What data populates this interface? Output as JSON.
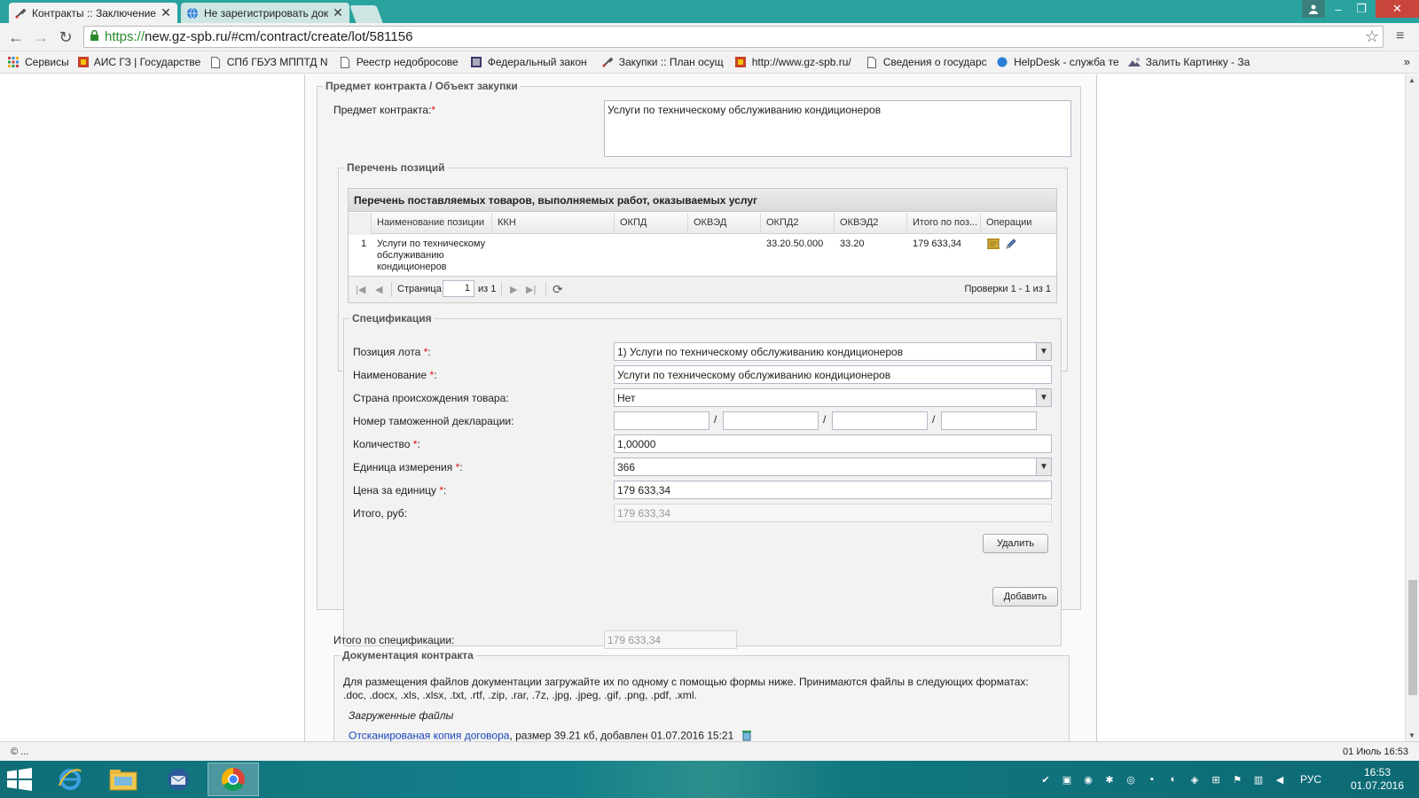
{
  "browser": {
    "tabs": [
      {
        "label": "Контракты :: Заключение",
        "icon": "tools-icon",
        "active": true
      },
      {
        "label": "Не зарегистрировать док",
        "icon": "globe-icon",
        "active": false
      }
    ],
    "url_scheme": "https://",
    "url_rest": "new.gz-spb.ru/#cm/contract/create/lot/581156",
    "bookmarks": [
      {
        "label": "Сервисы",
        "icon": "apps-icon"
      },
      {
        "label": "АИС ГЗ | Государстве",
        "icon": "gz-icon"
      },
      {
        "label": "СПб ГБУЗ МППТД N",
        "icon": "page-icon"
      },
      {
        "label": "Реестр недобросове",
        "icon": "page-icon"
      },
      {
        "label": "Федеральный закон",
        "icon": "doc-icon"
      },
      {
        "label": "Закупки :: План осущ",
        "icon": "tools-icon"
      },
      {
        "label": "http://www.gz-spb.ru/",
        "icon": "gz-icon"
      },
      {
        "label": "Сведения о государс",
        "icon": "page-icon"
      },
      {
        "label": "HelpDesk - служба те",
        "icon": "globe-icon"
      },
      {
        "label": "Залить Картинку - За",
        "icon": "image-icon"
      }
    ]
  },
  "form": {
    "section_subject_legend": "Предмет контракта / Объект закупки",
    "subject_label": "Предмет контракта:",
    "required_mark": "*",
    "subject_value": "Услуги по техническому обслуживанию кондиционеров",
    "positions_legend": "Перечень позиций",
    "grid": {
      "title": "Перечень поставляемых товаров, выполняемых работ, оказываемых услуг",
      "columns": [
        "Наименование позиции",
        "ККН",
        "ОКПД",
        "ОКВЭД",
        "ОКПД2",
        "ОКВЭД2",
        "Итого по поз...",
        "Операции"
      ],
      "row": {
        "num": "1",
        "name_line1": "Услуги по техническому",
        "name_line2": "обслуживанию",
        "name_line3": "кондиционеров",
        "kkn": "",
        "okpd": "",
        "okved": "",
        "okpd2": "33.20.50.000",
        "okved2": "33.20",
        "total": "179 633,34"
      },
      "pager": {
        "page_label": "Страница",
        "page_value": "1",
        "of_label": "из 1",
        "summary": "Проверки 1 - 1 из 1"
      }
    },
    "spec": {
      "legend": "Спецификация",
      "lot_position_label": "Позиция лота",
      "lot_position_value": "1) Услуги по техническому обслуживанию кондиционеров",
      "name_label": "Наименование",
      "name_value": "Услуги по техническому обслуживанию кондиционеров",
      "country_label": "Страна происхождения товара:",
      "country_value": "Нет",
      "customs_label": "Номер таможенной декларации:",
      "customs_sep": "/",
      "qty_label": "Количество",
      "qty_value": "1,00000",
      "unit_label": "Единица измерения",
      "unit_value": "366",
      "price_label": "Цена за единицу",
      "price_value": "179 633,34",
      "total_label": "Итого, руб:",
      "total_value": "179 633,34",
      "delete_button": "Удалить",
      "colon": ":"
    },
    "add_button": "Добавить",
    "spec_total_label": "Итого по спецификации:",
    "spec_total_value": "179 633,34",
    "docs": {
      "legend": "Документация контракта",
      "info_line1": "Для размещения файлов документации загружайте их по одному с помощью формы ниже. Принимаются файлы в следующих форматах:",
      "info_line2": ".doc, .docx, .xls, .xlsx, .txt, .rtf, .zip, .rar, .7z, .jpg, .jpeg, .gif, .png, .pdf, .xml.",
      "uploaded_label": "Загруженные файлы",
      "file_link": "Отсканированая копия договора",
      "file_meta": ", размер 39.21 кб, добавлен 01.07.2016 15:21"
    }
  },
  "statusbar": {
    "left": "© ...",
    "right": "01 Июль 16:53"
  },
  "taskbar": {
    "lang": "РУС",
    "time": "16:53",
    "date": "01.07.2016"
  },
  "colors": {
    "titlebar": "#2aa39f",
    "link": "#1a44b8",
    "required": "#dd1111"
  }
}
